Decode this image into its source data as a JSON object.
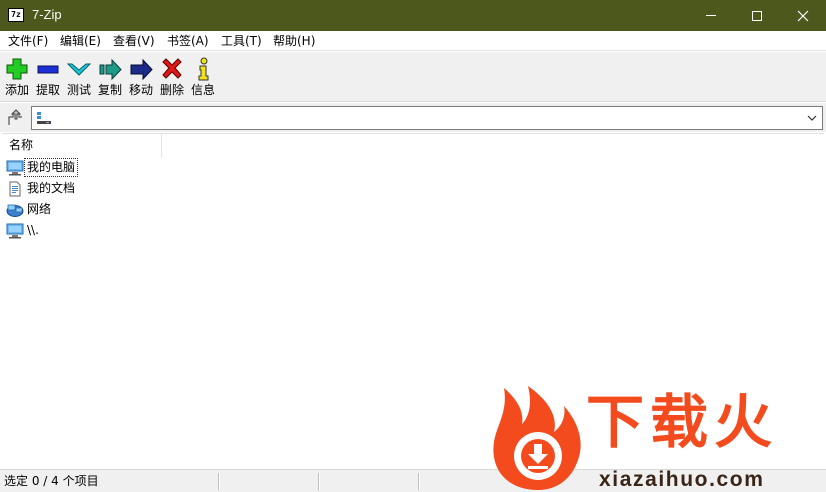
{
  "window": {
    "title": "7-Zip",
    "app_icon_text": "7z",
    "controls": [
      "minimize",
      "maximize",
      "close"
    ]
  },
  "menu": {
    "items": [
      {
        "label": "文件(F)"
      },
      {
        "label": "编辑(E)"
      },
      {
        "label": "查看(V)"
      },
      {
        "label": "书签(A)"
      },
      {
        "label": "工具(T)"
      },
      {
        "label": "帮助(H)"
      }
    ]
  },
  "toolbar": {
    "buttons": [
      {
        "label": "添加",
        "icon": "plus-icon",
        "color": "#22cc22"
      },
      {
        "label": "提取",
        "icon": "minus-icon",
        "color": "#1b2fd6"
      },
      {
        "label": "测试",
        "icon": "check-chevron-icon",
        "color": "#19c5d6"
      },
      {
        "label": "复制",
        "icon": "copy-arrow-icon",
        "color": "#1e9a8a"
      },
      {
        "label": "移动",
        "icon": "move-arrow-icon",
        "color": "#1c2a8a"
      },
      {
        "label": "删除",
        "icon": "delete-x-icon",
        "color": "#e01818"
      },
      {
        "label": "信息",
        "icon": "info-icon",
        "color": "#f2e21a"
      }
    ]
  },
  "address": {
    "value": "",
    "icon": "computer-small-icon"
  },
  "file_list": {
    "columns": [
      {
        "label": "名称"
      }
    ],
    "rows": [
      {
        "name": "我的电脑",
        "icon": "computer-icon",
        "focused": true
      },
      {
        "name": "我的文档",
        "icon": "document-icon",
        "focused": false
      },
      {
        "name": "网络",
        "icon": "network-icon",
        "focused": false
      },
      {
        "name": "\\\\.",
        "icon": "computer-icon",
        "focused": false
      }
    ]
  },
  "status": {
    "text": "选定 0 / 4 个项目"
  },
  "watermark": {
    "cn_text": "下载火",
    "url_text": "xiazaihuo.com",
    "color": "#f34b1d"
  }
}
